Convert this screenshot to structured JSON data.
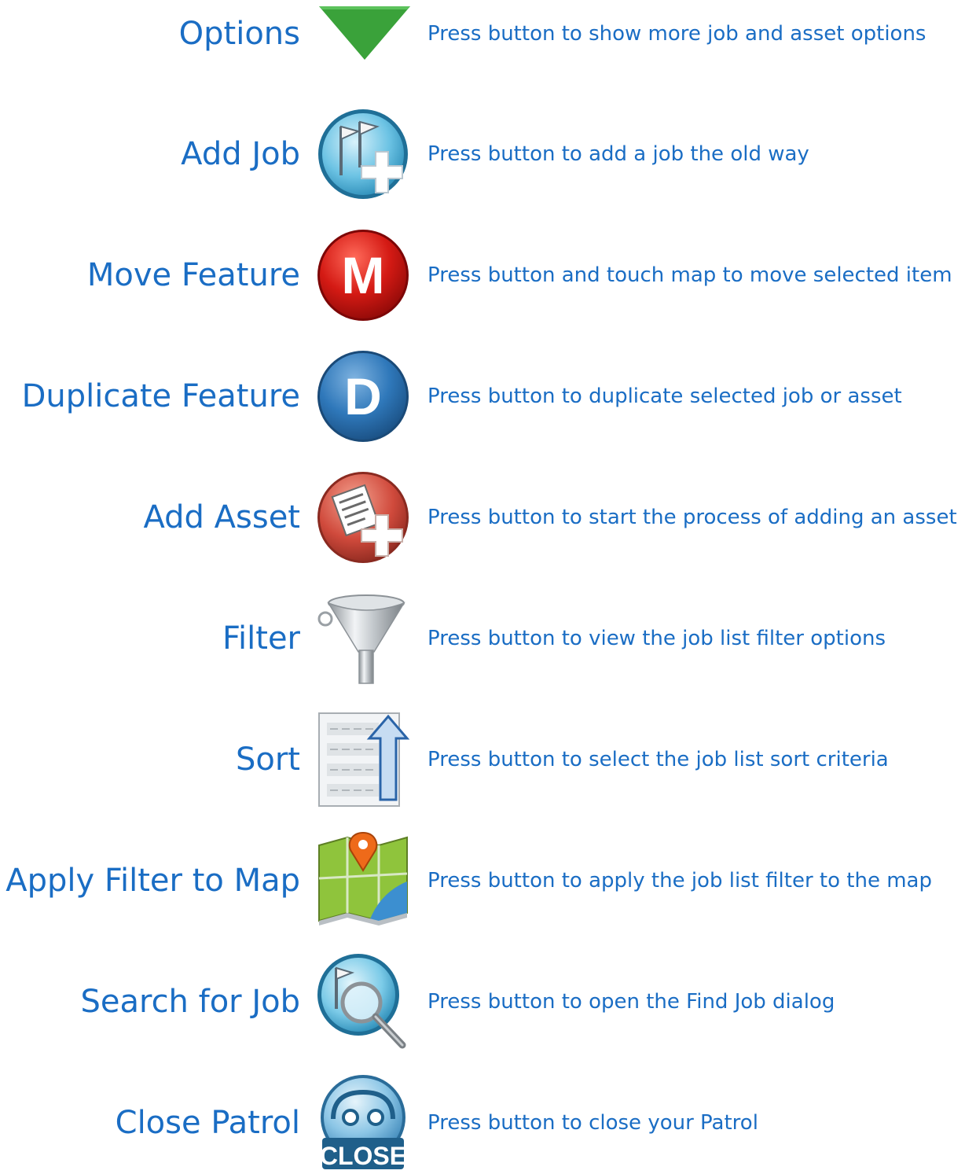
{
  "rows": [
    {
      "label": "Options",
      "icon": "dropdown-triangle-icon",
      "description": "Press button to show more job and asset options"
    },
    {
      "label": "Add Job",
      "icon": "add-job-icon",
      "description": "Press button to add a job the old way"
    },
    {
      "label": "Move Feature",
      "icon": "move-feature-icon",
      "description": "Press button and touch map to move selected item"
    },
    {
      "label": "Duplicate Feature",
      "icon": "duplicate-feature-icon",
      "description": "Press button to duplicate selected job or asset"
    },
    {
      "label": "Add Asset",
      "icon": "add-asset-icon",
      "description": "Press button to start the process of adding an asset"
    },
    {
      "label": "Filter",
      "icon": "funnel-icon",
      "description": "Press button to view the job list filter options"
    },
    {
      "label": "Sort",
      "icon": "sort-list-icon",
      "description": "Press button to select the job list sort criteria"
    },
    {
      "label": "Apply Filter to Map",
      "icon": "map-pin-icon",
      "description": "Press button to apply the job list filter to the map"
    },
    {
      "label": "Search for Job",
      "icon": "search-job-icon",
      "description": "Press button to open the Find Job dialog"
    },
    {
      "label": "Close Patrol",
      "icon": "close-patrol-icon",
      "description": "Press button to close your Patrol"
    }
  ],
  "icon_text": {
    "move": "M",
    "duplicate": "D",
    "close": "CLOSE"
  },
  "colors": {
    "text": "#1a6dc4",
    "options_green": "#3aa23a",
    "move_red": "#cc1111",
    "duplicate_blue": "#2e77b8",
    "add_asset_red": "#d04a3c",
    "add_job_teal": "#3aa5cf",
    "close_blue": "#4a90c8"
  }
}
